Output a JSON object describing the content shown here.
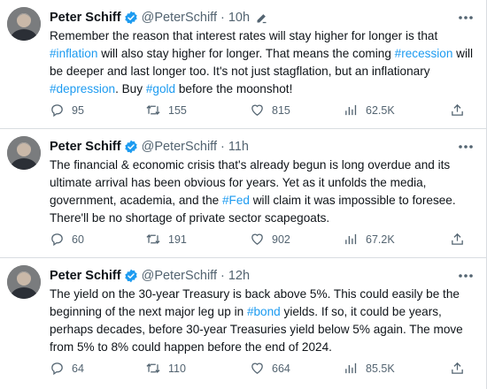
{
  "tweets": [
    {
      "name": "Peter Schiff",
      "handle": "@PeterSchiff",
      "sep": "·",
      "time": "10h",
      "body": [
        {
          "t": "Remember the reason that interest rates will stay higher for longer is that "
        },
        {
          "t": "#inflation",
          "tag": true
        },
        {
          "t": " will also stay higher for longer. That means the coming "
        },
        {
          "t": "#recession",
          "tag": true
        },
        {
          "t": " will be deeper and last longer too. It's not just stagflation, but an inflationary "
        },
        {
          "t": "#depression",
          "tag": true
        },
        {
          "t": ". Buy "
        },
        {
          "t": "#gold",
          "tag": true
        },
        {
          "t": " before the moonshot!"
        }
      ],
      "replies": "95",
      "retweets": "155",
      "likes": "815",
      "views": "62.5K"
    },
    {
      "name": "Peter Schiff",
      "handle": "@PeterSchiff",
      "sep": "·",
      "time": "11h",
      "body": [
        {
          "t": "The financial & economic crisis that's already begun is long overdue and its ultimate arrival has been obvious for years. Yet as it unfolds the media, government, academia, and the "
        },
        {
          "t": "#Fed",
          "tag": true
        },
        {
          "t": " will claim it was impossible to foresee. There'll be no shortage of private sector scapegoats."
        }
      ],
      "replies": "60",
      "retweets": "191",
      "likes": "902",
      "views": "67.2K"
    },
    {
      "name": "Peter Schiff",
      "handle": "@PeterSchiff",
      "sep": "·",
      "time": "12h",
      "body": [
        {
          "t": "The yield on the 30-year Treasury is back above 5%. This could easily be the beginning of the next major leg up in "
        },
        {
          "t": "#bond",
          "tag": true
        },
        {
          "t": " yields. If so, it could be years, perhaps decades, before 30-year Treasuries yield below 5% again. The move from 5% to 8% could happen before the end of 2024."
        }
      ],
      "replies": "64",
      "retweets": "110",
      "likes": "664",
      "views": "85.5K"
    }
  ],
  "colors": {
    "accent": "#1d9bf0",
    "text": "#0f1419",
    "muted": "#536471"
  },
  "icons": [
    "verified-badge-icon",
    "edit-icon",
    "more-icon",
    "reply-icon",
    "retweet-icon",
    "like-icon",
    "views-icon",
    "share-icon"
  ]
}
